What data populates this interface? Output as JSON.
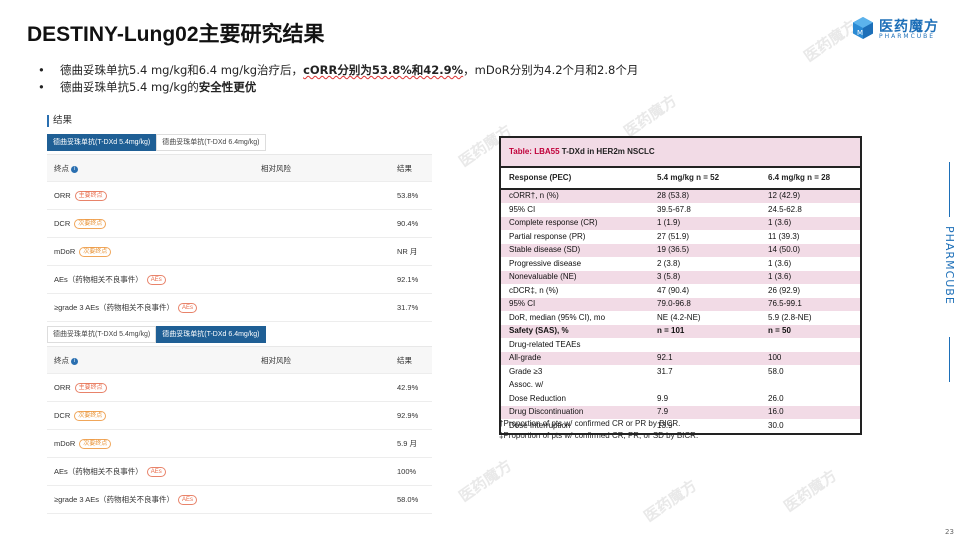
{
  "title": "DESTINY-Lung02主要研究结果",
  "logo": {
    "cn": "医药魔方",
    "en": "PHARMCUBE",
    "brand_color": "#1d6fb8"
  },
  "bullets": [
    {
      "prefix": "德曲妥珠单抗5.4 mg/kg和6.4 mg/kg治疗后，",
      "bold": "cORR分别为53.8%和42.9%",
      "suffix": "，mDoR分别为4.2个月和2.8个月"
    },
    {
      "prefix": "德曲妥珠单抗5.4 mg/kg的",
      "bold": "安全性更优",
      "suffix": ""
    }
  ],
  "results": {
    "section_label": "结果",
    "tab_a": "德曲妥珠单抗(T-DXd 5.4mg/kg)",
    "tab_b": "德曲妥珠单抗(T-DXd 6.4mg/kg)",
    "col_endpoint": "终点",
    "col_risk": "相对风险",
    "col_result": "结果",
    "tag_primary": "主要终点",
    "tag_secondary": "次要终点",
    "tag_ae": "AEs",
    "rows_labels": [
      "ORR",
      "DCR",
      "mDoR",
      "AEs（药物相关不良事件）",
      "≥grade 3 AEs（药物相关不良事件）"
    ],
    "table1_values": [
      "53.8%",
      "90.4%",
      "NR 月",
      "92.1%",
      "31.7%"
    ],
    "table2_values": [
      "42.9%",
      "92.9%",
      "5.9 月",
      "100%",
      "58.0%"
    ]
  },
  "lba": {
    "caption_red": "Table: LBA55",
    "caption_rest": "T-DXd in HER2m NSCLC",
    "head": [
      "Response (PEC)",
      "5.4 mg/kg n = 52",
      "6.4 mg/kg n = 28"
    ],
    "rows": [
      [
        "cORR†, n (%)",
        "28 (53.8)",
        "12 (42.9)"
      ],
      [
        "95% CI",
        "39.5-67.8",
        "24.5-62.8"
      ],
      [
        "Complete response (CR)",
        "1 (1.9)",
        "1 (3.6)"
      ],
      [
        "Partial response (PR)",
        "27 (51.9)",
        "11 (39.3)"
      ],
      [
        "Stable disease (SD)",
        "19 (36.5)",
        "14 (50.0)"
      ],
      [
        "Progressive disease",
        "2 (3.8)",
        "1 (3.6)"
      ],
      [
        "Nonevaluable (NE)",
        "3 (5.8)",
        "1 (3.6)"
      ],
      [
        "cDCR‡, n (%)",
        "47 (90.4)",
        "26 (92.9)"
      ],
      [
        "95% CI",
        "79.0-96.8",
        "76.5-99.1"
      ],
      [
        "DoR, median (95% CI), mo",
        "NE (4.2-NE)",
        "5.9 (2.8-NE)"
      ],
      [
        "Safety (SAS), %",
        "n = 101",
        "n = 50"
      ],
      [
        "Drug-related TEAEs",
        "",
        ""
      ],
      [
        "All-grade",
        "92.1",
        "100"
      ],
      [
        "Grade ≥3",
        "31.7",
        "58.0"
      ],
      [
        "Assoc. w/",
        "",
        ""
      ],
      [
        "Dose Reduction",
        "9.9",
        "26.0"
      ],
      [
        "Drug Discontinuation",
        "7.9",
        "16.0"
      ],
      [
        "Dose Interruption",
        "13.9",
        "30.0"
      ]
    ],
    "footnotes": [
      "†Proportion of pts w/ confirmed CR or PR by BICR.",
      "‡Proportion of pts w/ confirmed CR, PR, or SD by BICR."
    ]
  },
  "side_text": "PHARMCUBE",
  "page_number": "23"
}
